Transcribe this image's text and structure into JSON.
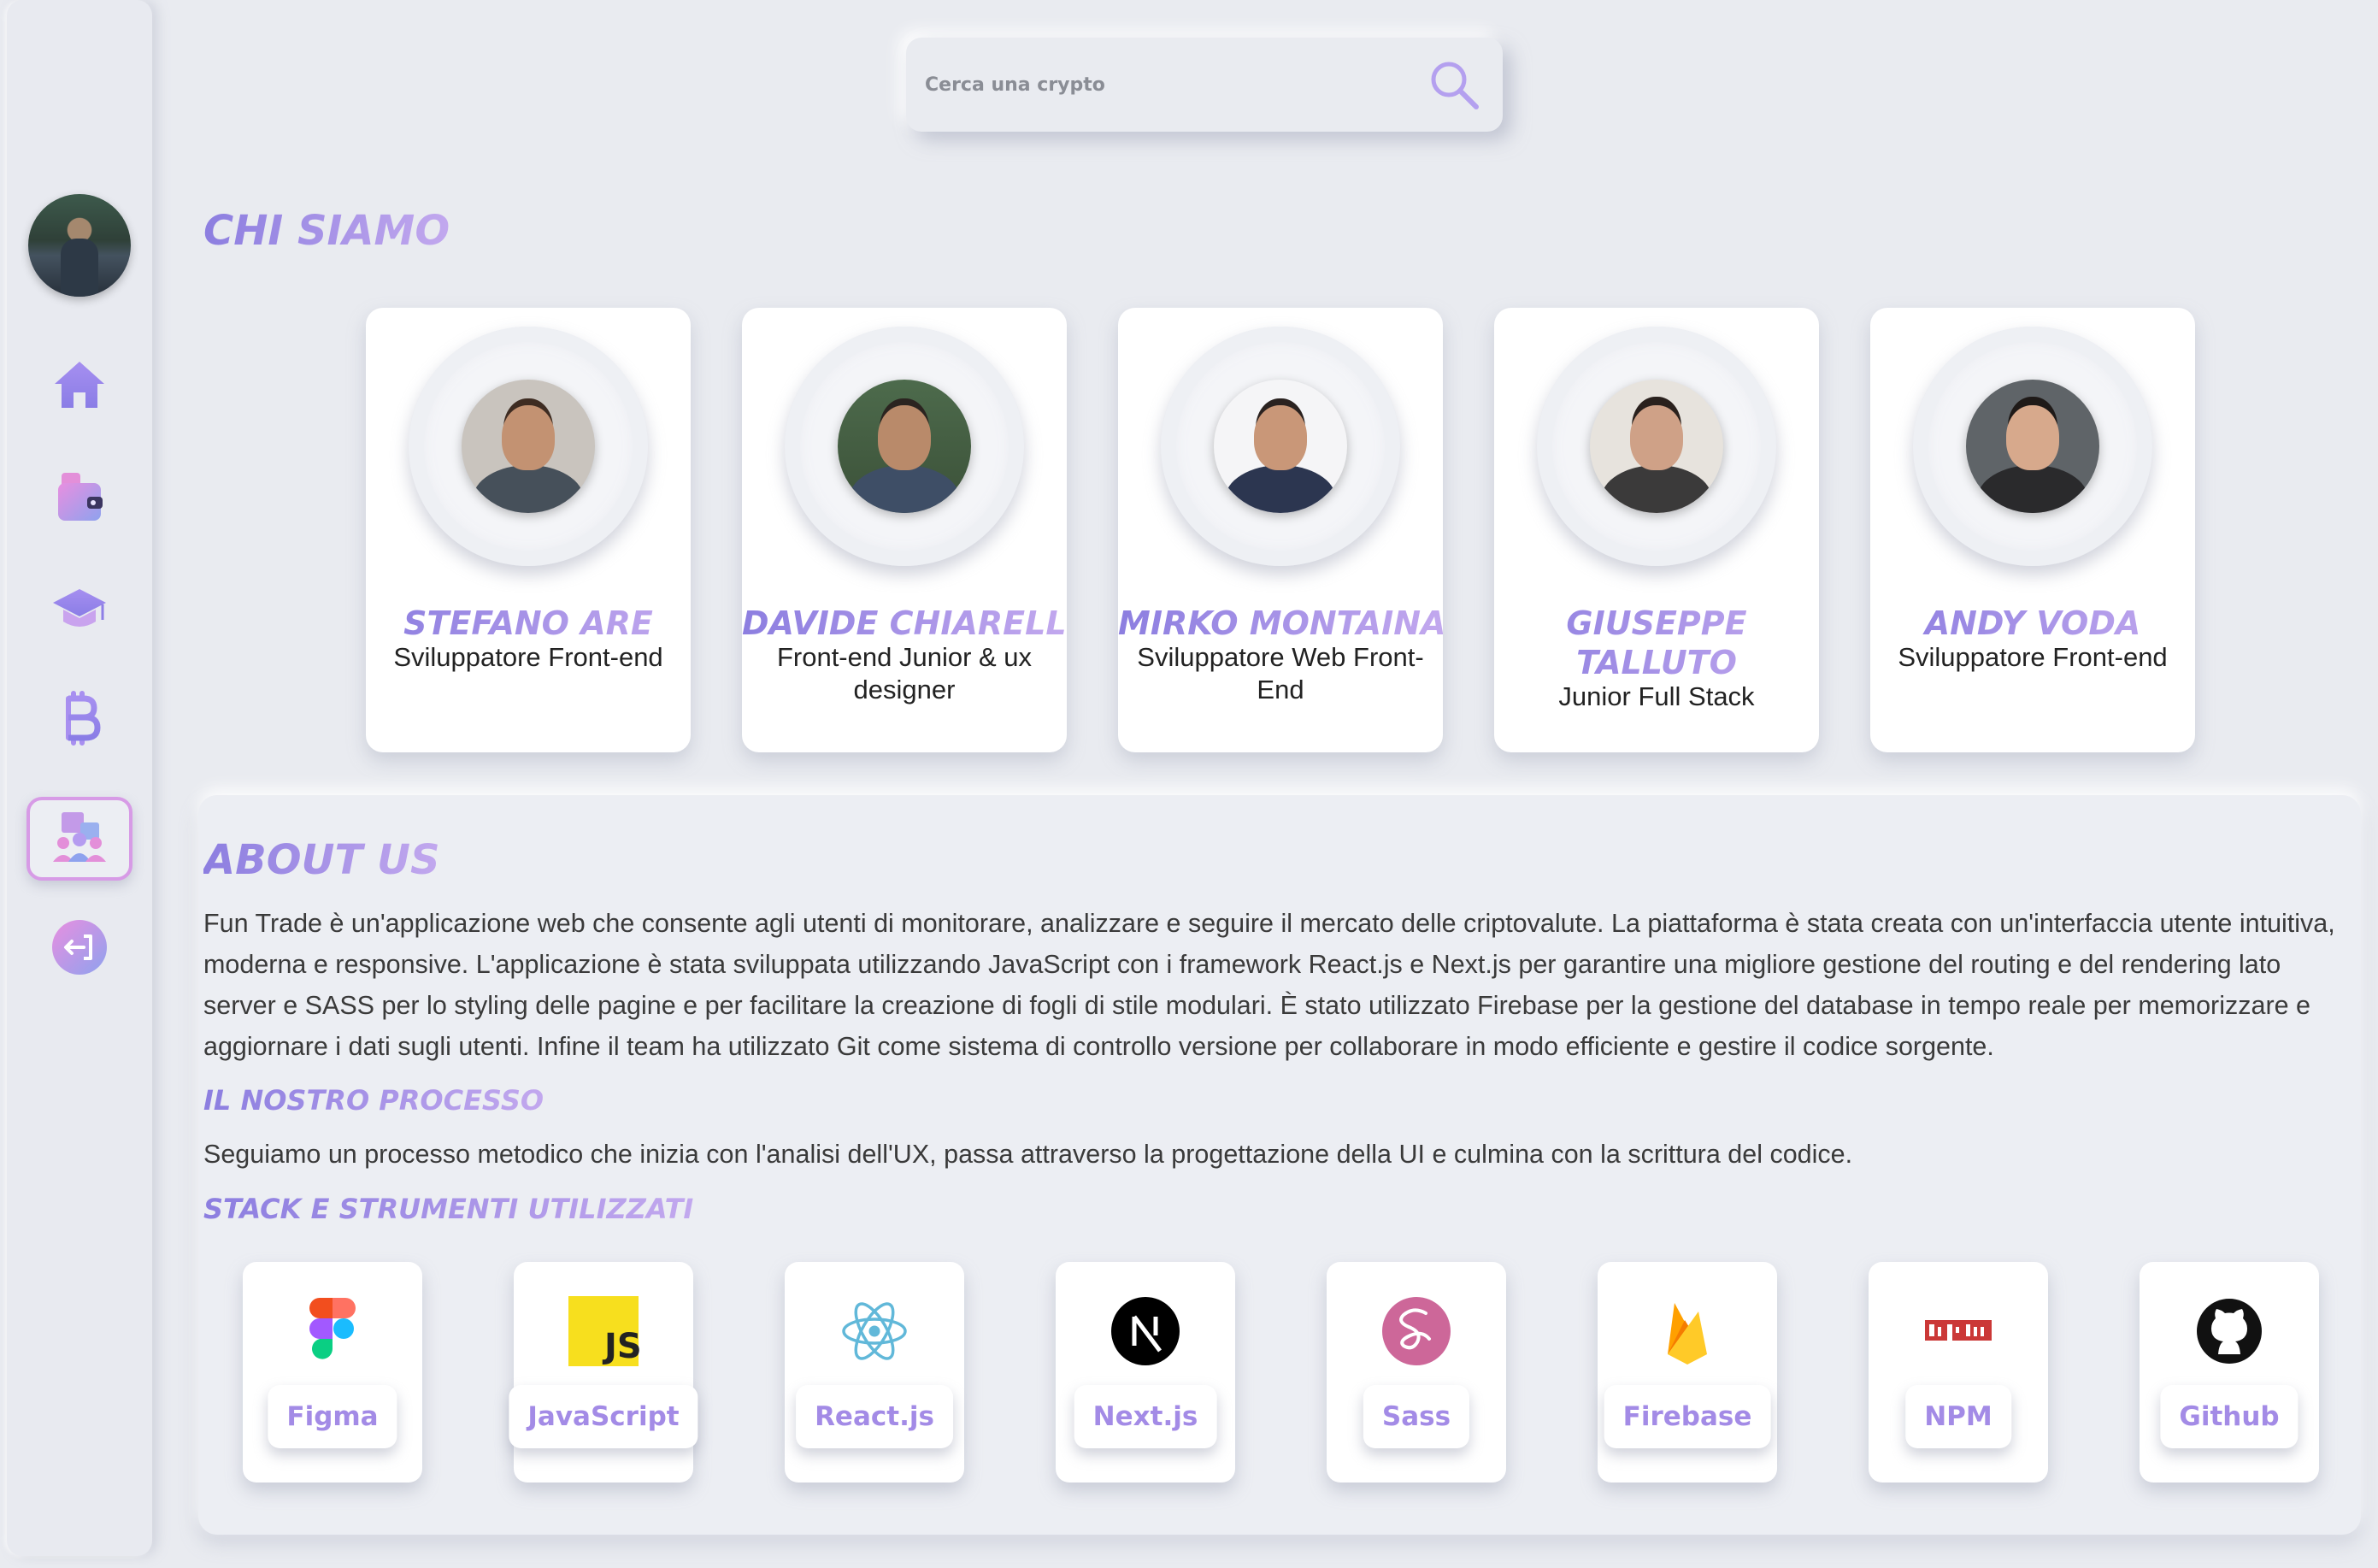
{
  "search": {
    "placeholder": "Cerca una crypto"
  },
  "sidebar": {
    "icons": [
      "waveform-logo-icon",
      "home-icon",
      "wallet-icon",
      "graduation-cap-icon",
      "bitcoin-icon",
      "team-icon",
      "logout-icon"
    ],
    "active_item": "team"
  },
  "team_section": {
    "title": "CHI SIAMO",
    "members": [
      {
        "name": "STEFANO ARE",
        "role": "Sviluppatore Front-end"
      },
      {
        "name": "DAVIDE CHIARELLI",
        "role": "Front-end Junior & ux designer"
      },
      {
        "name": "MIRKO MONTAINA",
        "role": "Sviluppatore Web Front-End"
      },
      {
        "name": "GIUSEPPE TALLUTO",
        "role": "Junior Full Stack"
      },
      {
        "name": "ANDY VODA",
        "role": "Sviluppatore Front-end"
      }
    ]
  },
  "about": {
    "title": "ABOUT US",
    "text": "Fun Trade è un'applicazione web che consente agli utenti di monitorare, analizzare e seguire il mercato delle criptovalute. La piattaforma è stata creata con un'interfaccia utente intuitiva, moderna e responsive. L'applicazione è stata sviluppata utilizzando JavaScript con i framework React.js e Next.js per garantire una migliore gestione del routing e del rendering lato server e SASS per lo styling delle pagine e per facilitare la creazione di fogli di stile modulari. È stato utilizzato Firebase per la gestione del database in tempo reale per memorizzare e aggiornare i dati sugli utenti. Infine il team ha utilizzato Git come sistema di controllo versione per collaborare in modo efficiente e gestire il codice sorgente.",
    "process_title": "IL NOSTRO PROCESSO",
    "process_text": "Seguiamo un processo metodico che inizia con l'analisi dell'UX, passa attraverso la progettazione della UI e culmina con la scrittura del codice.",
    "stack_title": "STACK E STRUMENTI UTILIZZATI",
    "tools": [
      {
        "label": "Figma",
        "icon": "figma-icon"
      },
      {
        "label": "JavaScript",
        "icon": "javascript-icon"
      },
      {
        "label": "React.js",
        "icon": "react-icon"
      },
      {
        "label": "Next.js",
        "icon": "nextjs-icon"
      },
      {
        "label": "Sass",
        "icon": "sass-icon"
      },
      {
        "label": "Firebase",
        "icon": "firebase-icon"
      },
      {
        "label": "NPM",
        "icon": "npm-icon"
      },
      {
        "label": "Github",
        "icon": "github-icon"
      }
    ]
  },
  "colors": {
    "accent_gradient_start": "#8c7ee0",
    "accent_gradient_end": "#c2a8ee",
    "active_border": "#d79be6",
    "background": "#e9ebf0"
  }
}
